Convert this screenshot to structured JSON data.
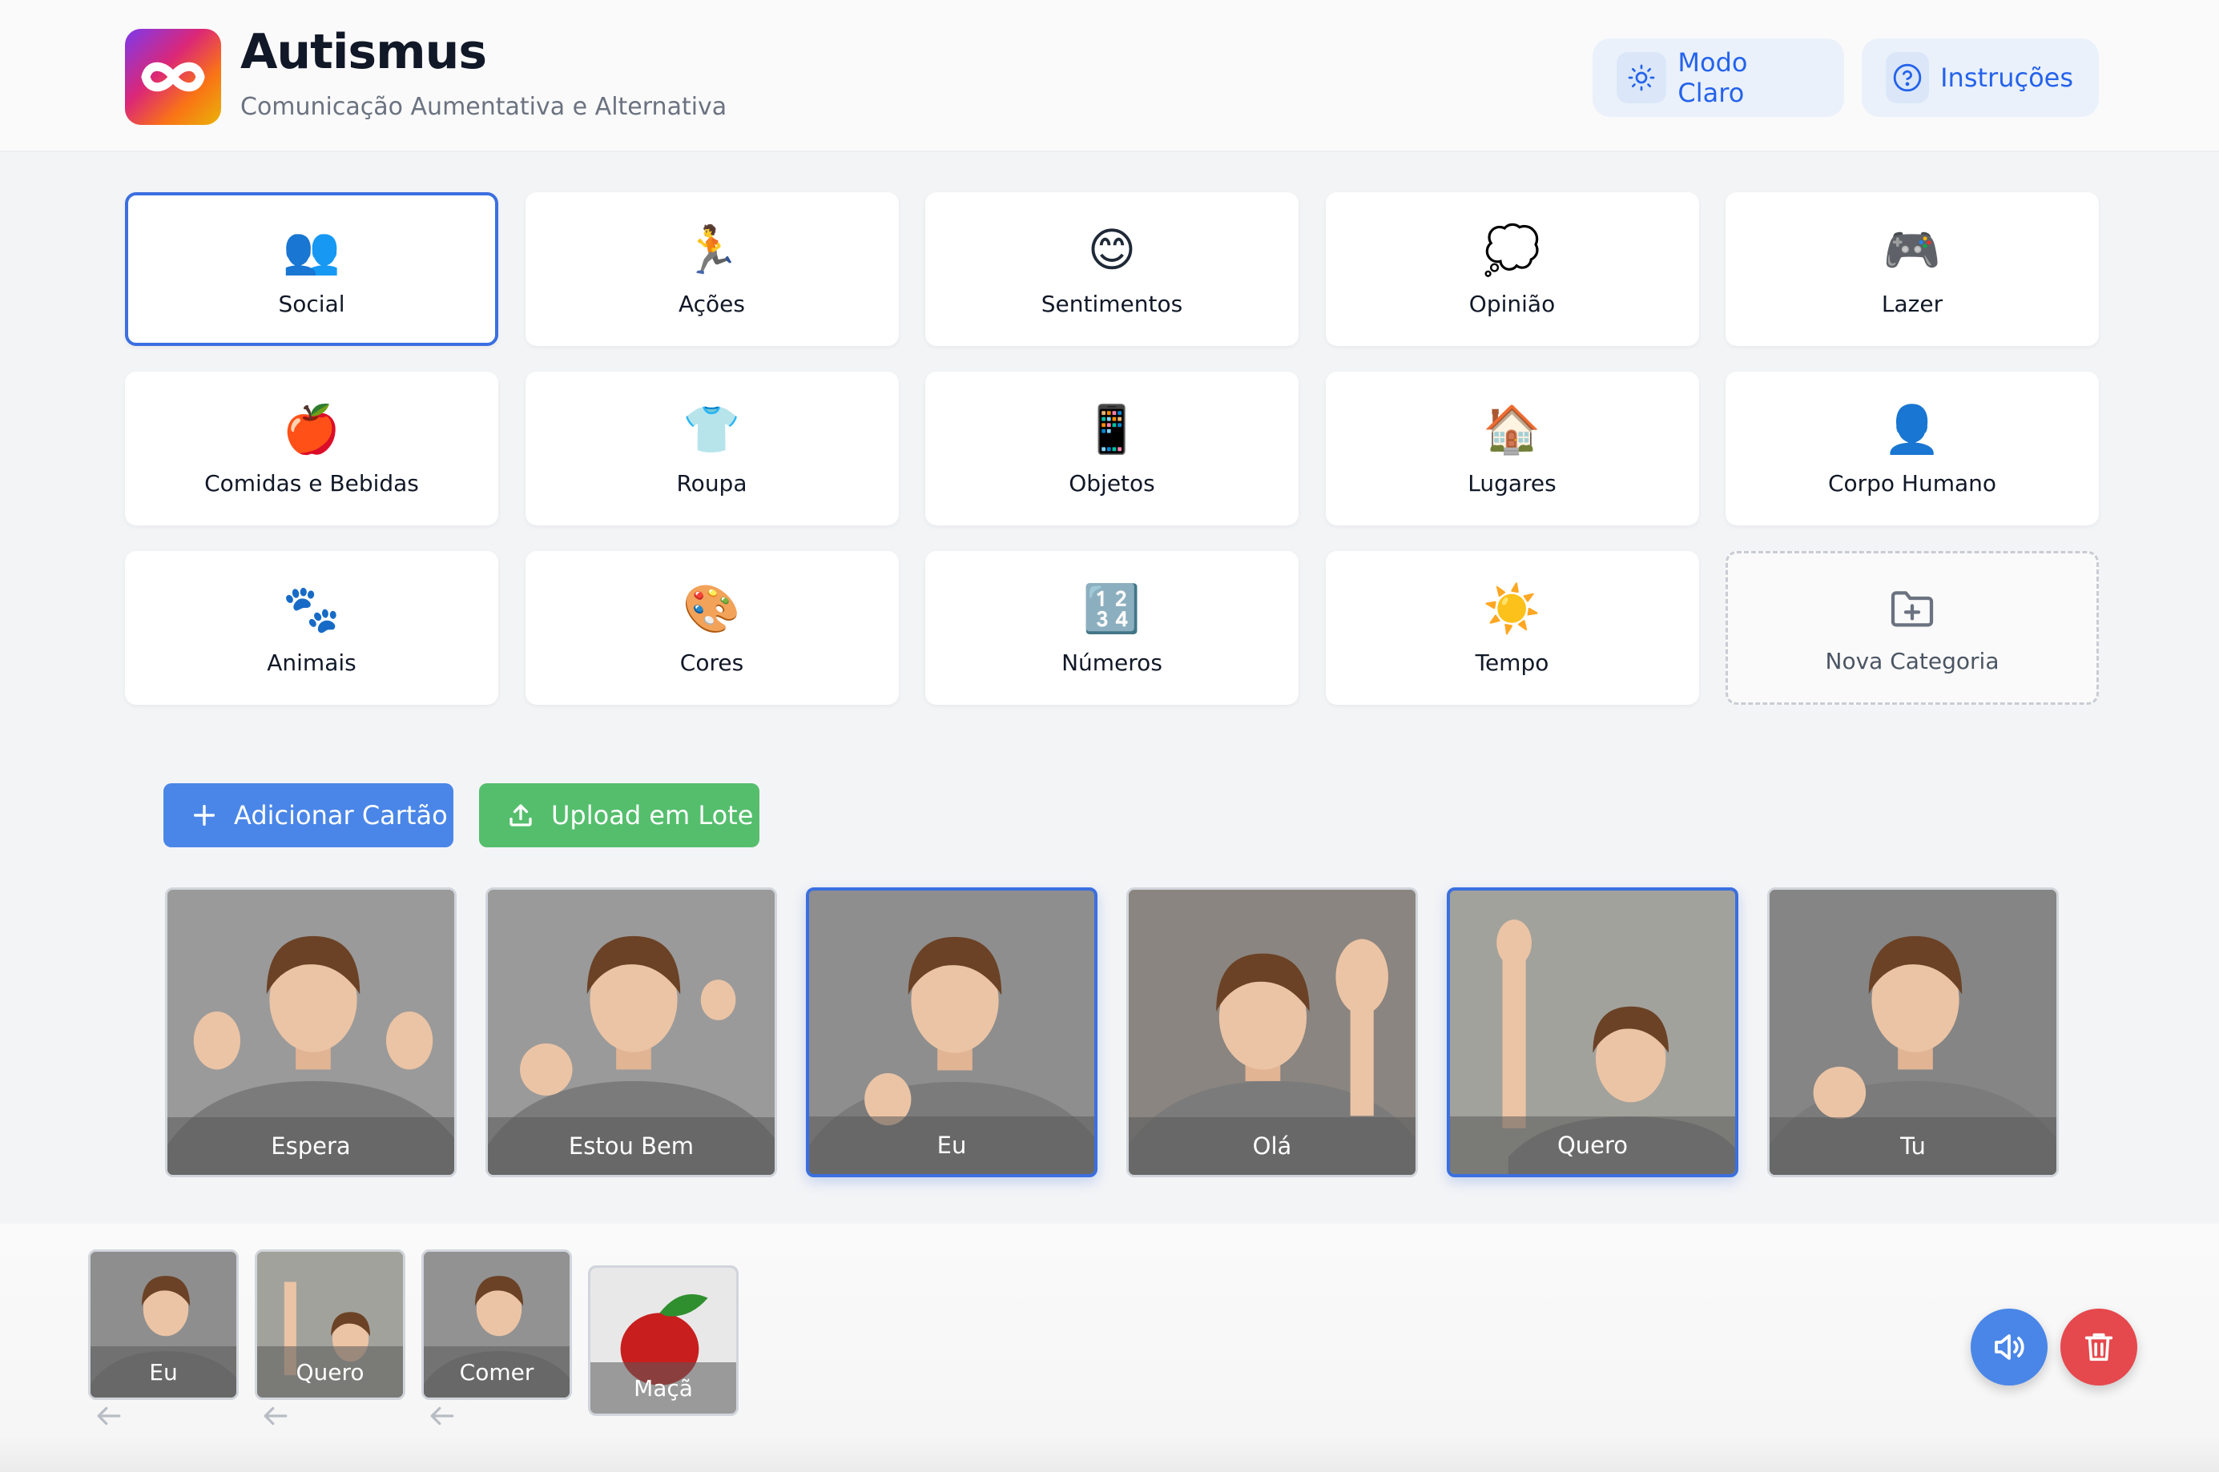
{
  "header": {
    "title": "Autismus",
    "subtitle": "Comunicação Aumentativa e Alternativa",
    "theme_button": "Modo Claro",
    "help_button": "Instruções"
  },
  "categories": [
    {
      "label": "Social",
      "emoji": "👥",
      "active": true
    },
    {
      "label": "Ações",
      "emoji": "🏃"
    },
    {
      "label": "Sentimentos",
      "emoji": "😊"
    },
    {
      "label": "Opinião",
      "emoji": "💭"
    },
    {
      "label": "Lazer",
      "emoji": "🎮"
    },
    {
      "label": "Comidas e Bebidas",
      "emoji": "🍎"
    },
    {
      "label": "Roupa",
      "emoji": "👕"
    },
    {
      "label": "Objetos",
      "emoji": "📱"
    },
    {
      "label": "Lugares",
      "emoji": "🏠"
    },
    {
      "label": "Corpo Humano",
      "emoji": "👤"
    },
    {
      "label": "Animais",
      "emoji": "🐾"
    },
    {
      "label": "Cores",
      "emoji": "🎨"
    },
    {
      "label": "Números",
      "emoji": "🔢"
    },
    {
      "label": "Tempo",
      "emoji": "☀️"
    }
  ],
  "new_category": "Nova Categoria",
  "actions": {
    "add_card": "Adicionar Cartão",
    "batch_upload": "Upload em Lote"
  },
  "cards": [
    {
      "label": "Espera",
      "selected": false
    },
    {
      "label": "Estou Bem",
      "selected": false
    },
    {
      "label": "Eu",
      "selected": true
    },
    {
      "label": "Olá",
      "selected": false
    },
    {
      "label": "Quero",
      "selected": true
    },
    {
      "label": "Tu",
      "selected": false
    }
  ],
  "sentence": [
    {
      "label": "Eu"
    },
    {
      "label": "Quero"
    },
    {
      "label": "Comer"
    },
    {
      "label": "Maçã"
    }
  ],
  "colors": {
    "accent": "#3b6fe0",
    "add_button": "#4a86e8",
    "upload_button": "#55be6d",
    "clear_button": "#e5484d"
  }
}
